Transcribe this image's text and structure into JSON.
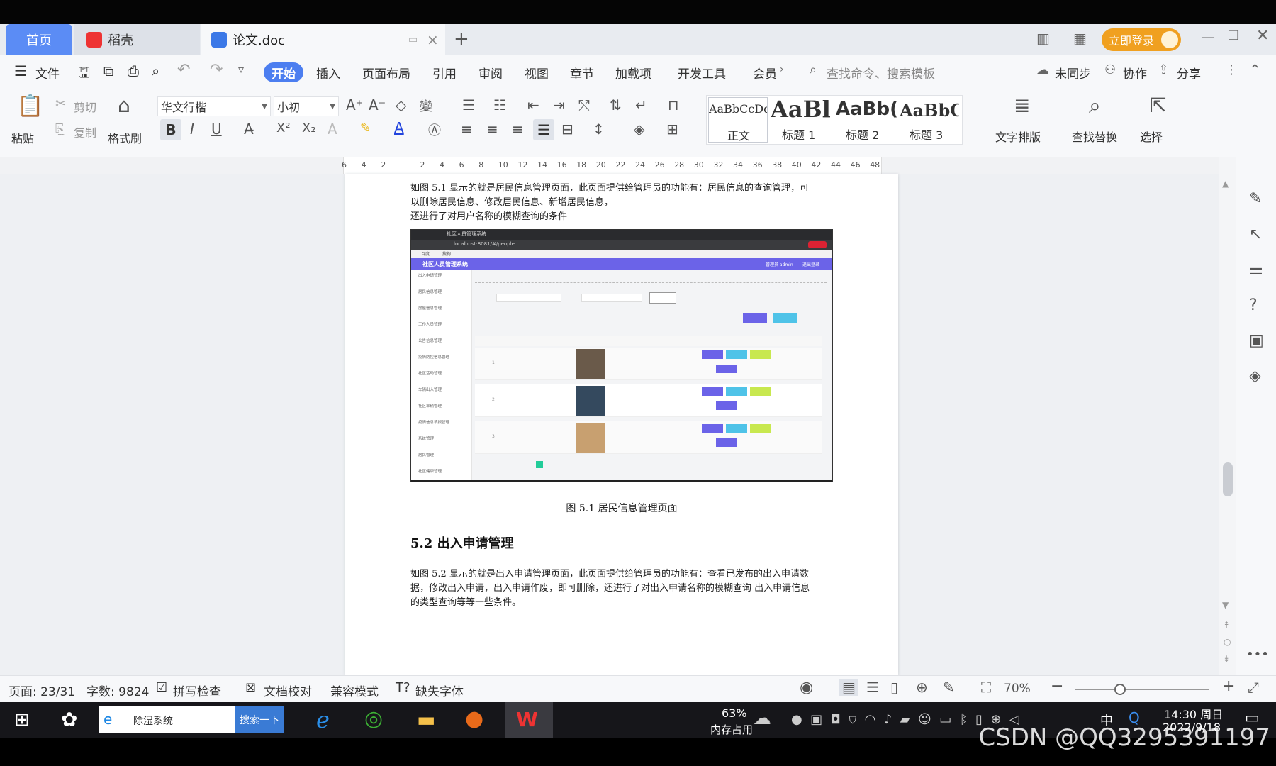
{
  "tabs": {
    "home": "首页",
    "daoke": "稻壳",
    "doc": "论文.doc",
    "login": "立即登录"
  },
  "menu": {
    "file": "文件",
    "start": "开始",
    "insert": "插入",
    "layout": "页面布局",
    "ref": "引用",
    "review": "审阅",
    "view": "视图",
    "chapter": "章节",
    "addin": "加载项",
    "dev": "开发工具",
    "member": "会员",
    "search_placeholder": "查找命令、搜索模板",
    "unsync": "未同步",
    "collab": "协作",
    "share": "分享"
  },
  "ribbon": {
    "paste": "粘贴",
    "cut": "剪切",
    "copy": "复制",
    "format_painter": "格式刷",
    "font": "华文行楷",
    "size": "小初",
    "styles": [
      {
        "sample": "AaBbCcDd",
        "name": "正文"
      },
      {
        "sample": "AaBl",
        "name": "标题 1"
      },
      {
        "sample": "AaBb(",
        "name": "标题 2"
      },
      {
        "sample": "AaBbC",
        "name": "标题 3"
      }
    ],
    "text_layout": "文字排版",
    "find_replace": "查找替换",
    "select": "选择"
  },
  "ruler": {
    "ticks": [
      "6",
      "4",
      "2",
      "",
      "2",
      "4",
      "6",
      "8",
      "10",
      "12",
      "14",
      "16",
      "18",
      "20",
      "22",
      "24",
      "26",
      "28",
      "30",
      "32",
      "34",
      "36",
      "38",
      "40",
      "42",
      "44",
      "46",
      "48"
    ]
  },
  "doc": {
    "para1_l1": "如图 5.1 显示的就是居民信息管理页面，此页面提供给管理员的功能有：居民信息的查询管理，可",
    "para1_l2": "以删除居民信息、修改居民信息、新增居民信息，",
    "para1_l3": "还进行了对用户名称的模糊查询的条件",
    "caption": "图 5.1  居民信息管理页面",
    "heading": "5.2  出入申请管理",
    "para2_l1": "如图 5.2 显示的就是出入申请管理页面，此页面提供给管理员的功能有：查看已发布的出入申请数",
    "para2_l2": "据，修改出入申请，出入申请作废，即可删除，还进行了对出入申请名称的模糊查询 出入申请信息",
    "para2_l3": "的类型查询等等一些条件。",
    "shot": {
      "tab": "社区人员管理系统",
      "url": "localhost:8081/#/people",
      "bookmarks": [
        "百度",
        "搜狗"
      ],
      "user": "管理员 admin",
      "logout": "退出登录",
      "sidebar": [
        "出入申请管理",
        "居民信息管理",
        "房屋信息管理",
        "工作人员管理",
        "公告信息管理",
        "疫情防控信息管理",
        "社区活动管理",
        "车辆出入管理",
        "社区车辆管理",
        "疫情信息填报管理",
        "系统管理",
        "居民管理",
        "社区健康管理"
      ],
      "title": "社区人员管理系统",
      "rows": [
        "1",
        "2",
        "3"
      ]
    }
  },
  "status": {
    "page": "页面: 23/31",
    "words": "字数: 9824",
    "spell": "拼写检查",
    "proof": "文档校对",
    "compat": "兼容模式",
    "missing_font": "缺失字体",
    "zoom": "70%"
  },
  "taskbar": {
    "search_text": "除湿系统",
    "search_btn": "搜索一下",
    "mem_pct": "63%",
    "mem_label": "内存占用",
    "ime": "中",
    "time": "14:30 周日",
    "date": "2022/9/18"
  },
  "watermark": "CSDN @QQ3295391197",
  "colors": {
    "accent": "#5b8cf5",
    "login": "#f0a020",
    "purple": "#6b63e8"
  }
}
